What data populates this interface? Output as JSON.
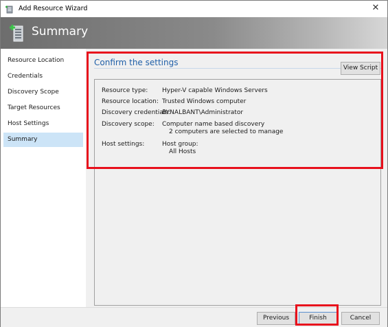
{
  "window": {
    "title": "Add Resource Wizard",
    "close_glyph": "✕"
  },
  "banner": {
    "title": "Summary"
  },
  "sidebar": {
    "items": [
      {
        "label": "Resource Location"
      },
      {
        "label": "Credentials"
      },
      {
        "label": "Discovery Scope"
      },
      {
        "label": "Target Resources"
      },
      {
        "label": "Host Settings"
      },
      {
        "label": "Summary",
        "selected": true
      }
    ]
  },
  "main": {
    "heading": "Confirm the settings",
    "view_script_label": "View Script",
    "settings": {
      "resource_type": {
        "label": "Resource type:",
        "value": "Hyper-V capable Windows Servers"
      },
      "resource_location": {
        "label": "Resource location:",
        "value": "Trusted Windows computer"
      },
      "discovery_credentials": {
        "label": "Discovery credentials:",
        "value": "BYNALBANT\\Administrator"
      },
      "discovery_scope": {
        "label": "Discovery scope:",
        "value": "Computer name based discovery",
        "detail": "2 computers are selected to manage"
      },
      "host_settings": {
        "label": "Host settings:",
        "value": "Host group:",
        "detail": "All Hosts"
      }
    }
  },
  "footer": {
    "previous_label": "Previous",
    "finish_label": "Finish",
    "cancel_label": "Cancel"
  },
  "colors": {
    "annotation_red": "#e8101c",
    "heading_blue": "#1f5fa8",
    "selected_nav": "#cce4f7"
  },
  "icons": [
    "wizard-app-icon",
    "wizard-banner-icon",
    "close-icon"
  ]
}
